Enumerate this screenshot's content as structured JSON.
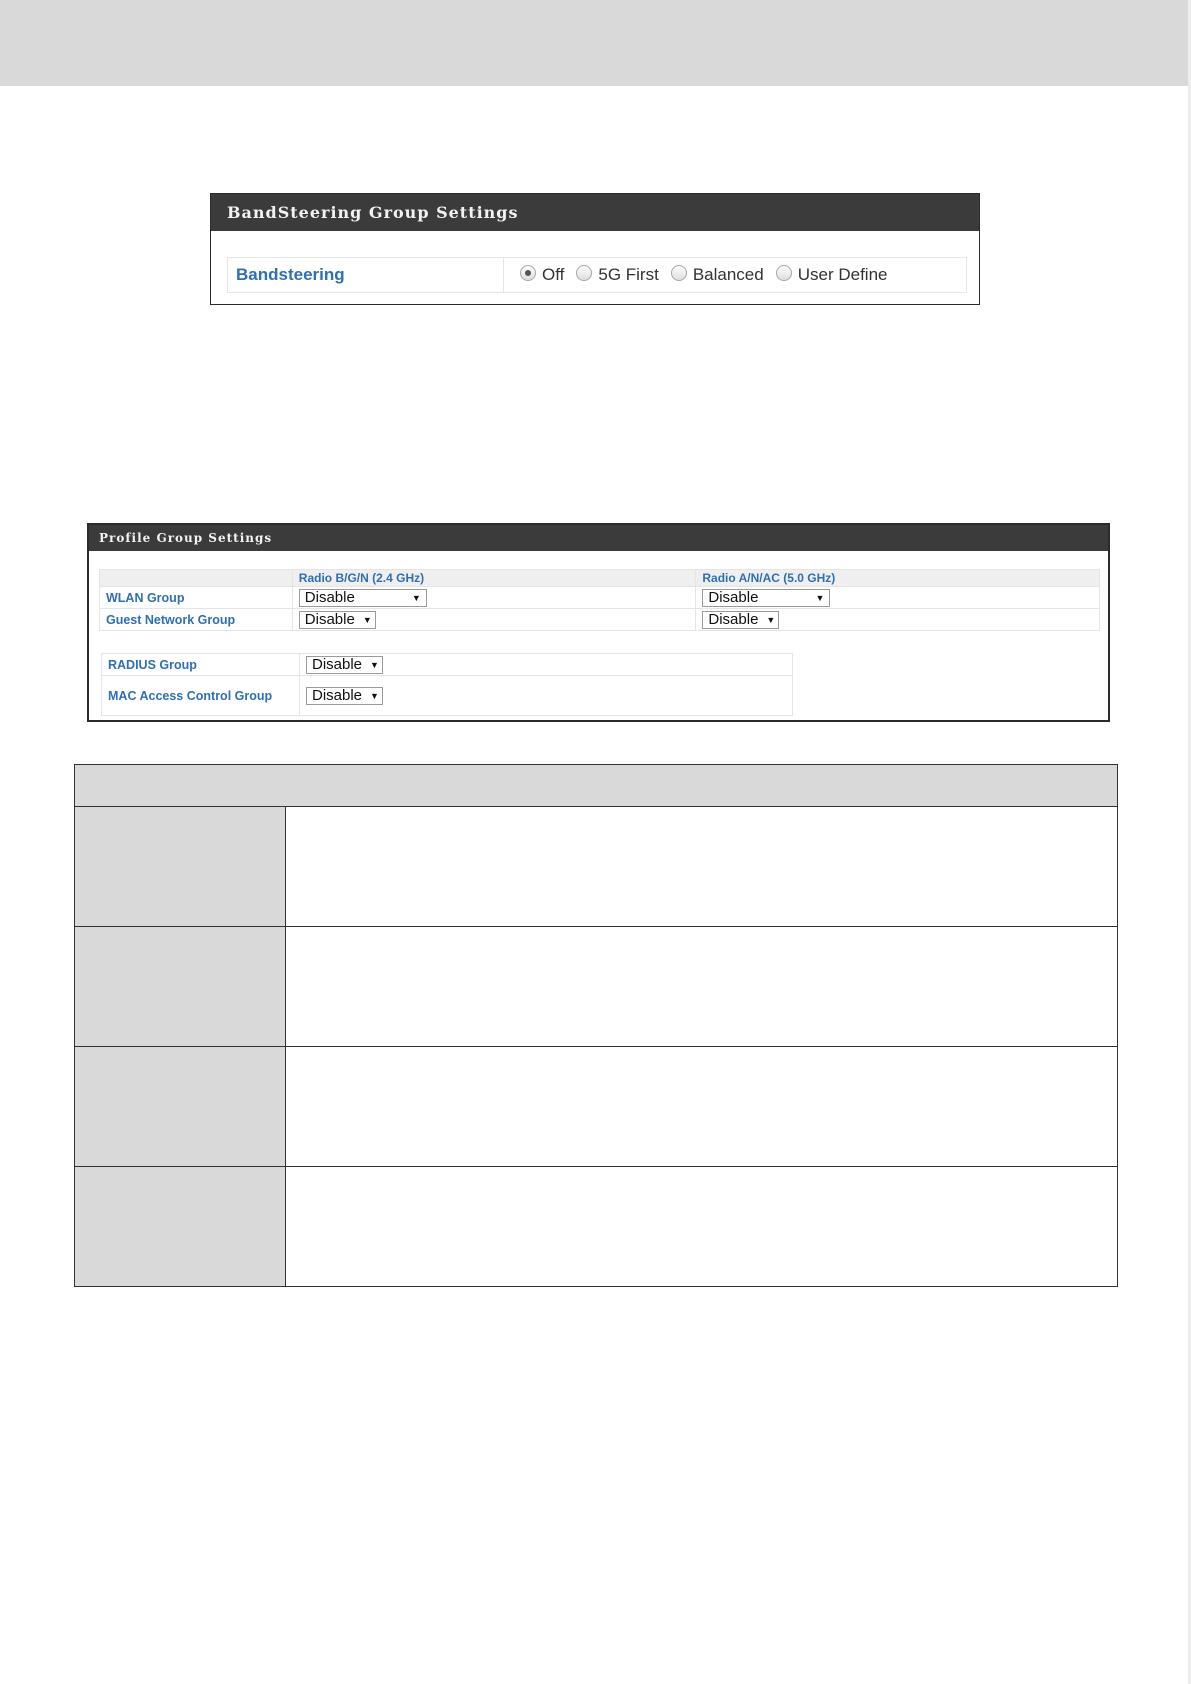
{
  "bandsteering_panel": {
    "title": "BandSteering Group Settings",
    "label": "Bandsteering",
    "options": [
      {
        "label": "Off",
        "checked": true
      },
      {
        "label": "5G First",
        "checked": false
      },
      {
        "label": "Balanced",
        "checked": false
      },
      {
        "label": "User Define",
        "checked": false
      }
    ]
  },
  "profile_panel": {
    "title": "Profile Group Settings",
    "columns": [
      "Radio B/G/N (2.4 GHz)",
      "Radio A/N/AC (5.0 GHz)"
    ],
    "rows": [
      {
        "label": "WLAN Group",
        "values": [
          "Disable",
          "Disable"
        ]
      },
      {
        "label": "Guest Network Group",
        "values": [
          "Disable",
          "Disable"
        ]
      }
    ],
    "rows2": [
      {
        "label": "RADIUS Group",
        "value": "Disable"
      },
      {
        "label": "MAC Access Control Group",
        "value": "Disable"
      }
    ]
  },
  "colors": {
    "header_bg": "#3b3b3b",
    "label_blue": "#2f6fb5",
    "band_gray": "#d9d9d9"
  }
}
